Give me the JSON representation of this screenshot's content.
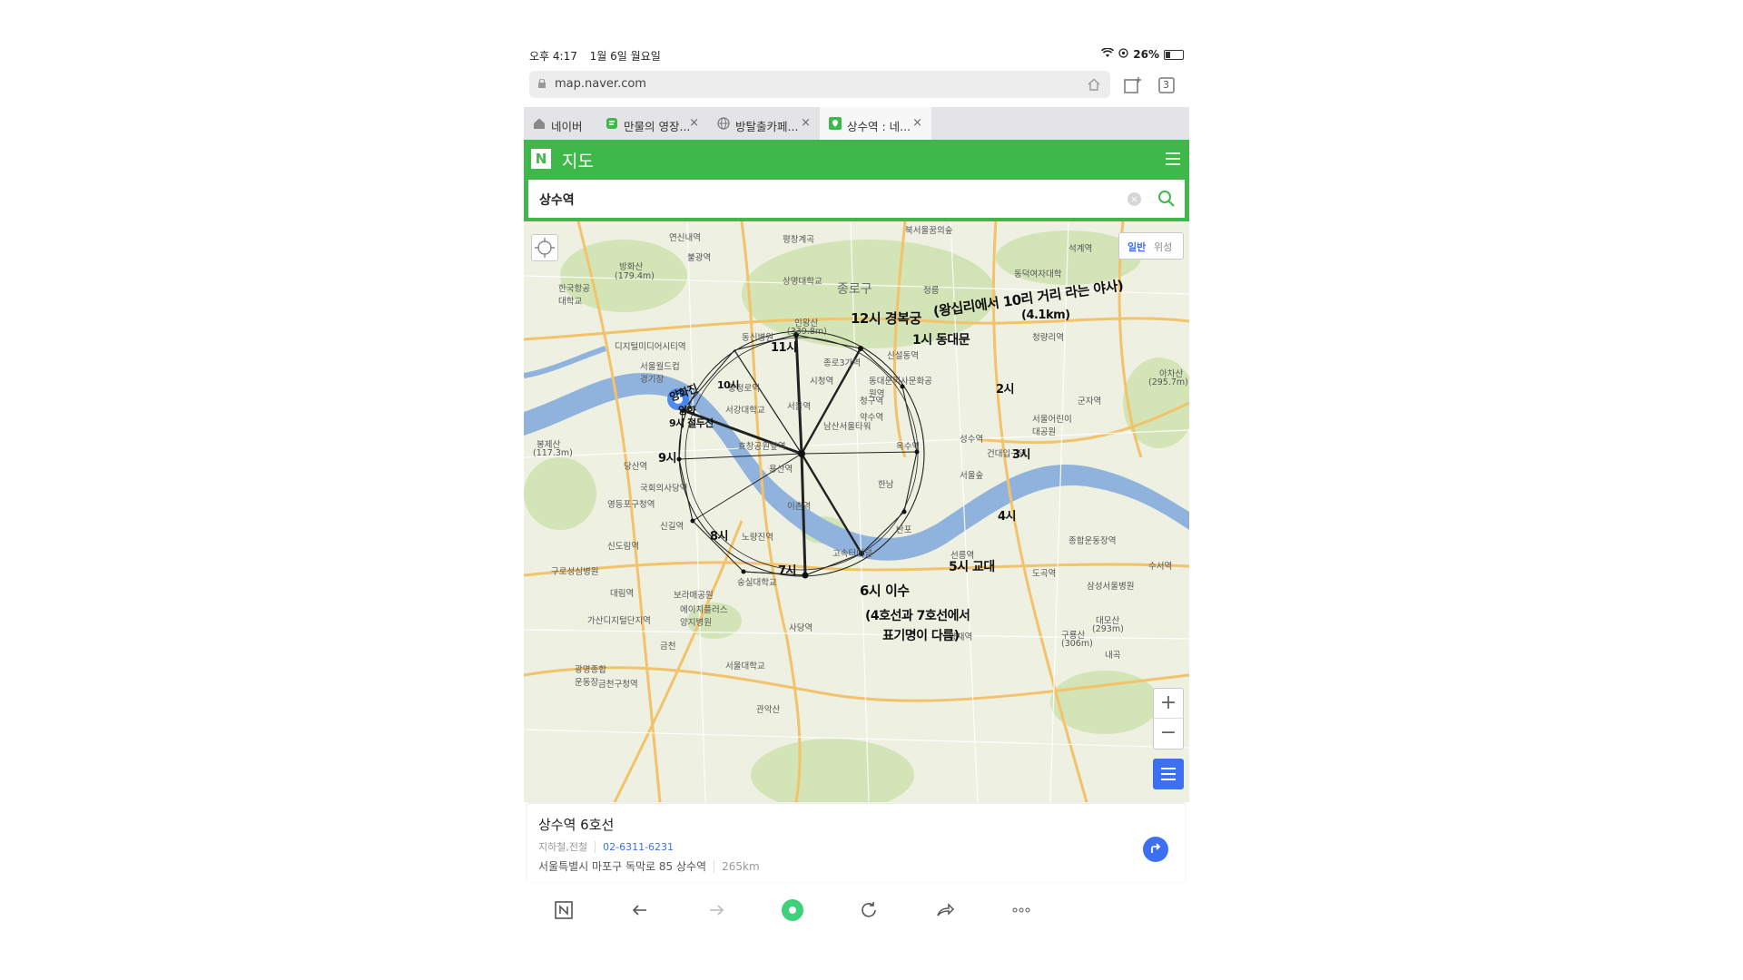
{
  "status": {
    "time": "오후 4:17",
    "date": "1월 6일 월요일",
    "battery": "26%"
  },
  "browser": {
    "url": "map.naver.com",
    "tab_count": "3",
    "tabs": [
      {
        "label": "네이버"
      },
      {
        "label": "만물의 영장..."
      },
      {
        "label": "방탈출카페..."
      },
      {
        "label": "상수역 : 네..."
      }
    ]
  },
  "app": {
    "logo": "N",
    "title": "지도"
  },
  "search": {
    "value": "상수역"
  },
  "map": {
    "view_general": "일반",
    "view_satellite": "위성",
    "zoom_in": "+",
    "zoom_out": "−",
    "district": "종로구",
    "labels": {
      "l1": "연신내역",
      "l2": "불광역",
      "l3": "평창계곡",
      "l4": "북서울꿈의숲",
      "l5": "석계역",
      "l6": "방화산",
      "l7": "(179.4m)",
      "l8": "한국항공대학교",
      "l9": "상명대학교",
      "l10": "정릉",
      "l11": "동덕여자대학",
      "l12": "디지털미디어시티역",
      "l13": "동신병원",
      "l14": "인왕산",
      "l15": "(339.8m)",
      "l16": "종로3가역",
      "l17": "신설동역",
      "l18": "청량리역",
      "l19": "서울월드컵경기장",
      "l20": "서울역",
      "l21": "충정로역",
      "l22": "서강대학교",
      "l23": "시청역",
      "l24": "동대문역사문화공원역",
      "l25": "청구역",
      "l26": "남산서울타워",
      "l27": "효창공원앞역",
      "l28": "용산역",
      "l29": "한남",
      "l30": "약수역",
      "l31": "옥수역",
      "l32": "성수역",
      "l33": "건대입구역",
      "l34": "서울어린이대공원",
      "l35": "봉제산",
      "l36": "(117.3m)",
      "l37": "당산역",
      "l38": "국회의사당역",
      "l39": "영등포구청역",
      "l40": "신길역",
      "l41": "노량진역",
      "l42": "이촌역",
      "l43": "반포",
      "l44": "고속터미널",
      "l45": "선릉역",
      "l46": "종합운동장역",
      "l47": "신도림역",
      "l48": "구로성심병원",
      "l49": "대림역",
      "l50": "보라매공원",
      "l51": "숭실대학교",
      "l52": "사당역",
      "l53": "양재역",
      "l54": "에이치플러스양지병원",
      "l55": "가산디지털단지역",
      "l56": "서울대학교",
      "l57": "광명종합운동장",
      "l58": "금천구청역",
      "l59": "관악산",
      "l60": "구룡산",
      "l61": "(306m)",
      "l62": "대모산",
      "l63": "(293m)",
      "l64": "삼성서울병원",
      "l65": "수서역",
      "l66": "아차산",
      "l67": "(295.7m)",
      "l68": "군자역",
      "l69": "내곡",
      "l70": "금천",
      "l71": "서울숲",
      "l72": "도곡역"
    }
  },
  "annotations": {
    "a12": "12시 경복궁",
    "a12b": "(왕십리에서 10리 거리 라는 야사)",
    "a12c": "(4.1km)",
    "a1": "1시 동대문",
    "a2": "2시",
    "a3": "3시",
    "a4": "4시",
    "a5": "5시 교대",
    "a6": "6시 이수",
    "a6b": "(4호선과 7호선에서",
    "a6c": "표기명이 다름)",
    "a7": "7시",
    "a8": "8시",
    "a9": "9시",
    "a10": "10시",
    "a11": "11시",
    "a_sj": "양화진",
    "a_sy": "양화",
    "a_st": "9시 절두산"
  },
  "info": {
    "name": "상수역 6호선",
    "category": "지하철,전철",
    "phone": "02-6311-6231",
    "address": "서울특별시 마포구 독막로 85 상수역",
    "distance": "265km"
  },
  "colors": {
    "naver_green": "#3fb84a",
    "accent_blue": "#3d6ff2",
    "river": "#8fb3dc",
    "park": "#cfe3b1",
    "road_major": "#f2c36a"
  }
}
